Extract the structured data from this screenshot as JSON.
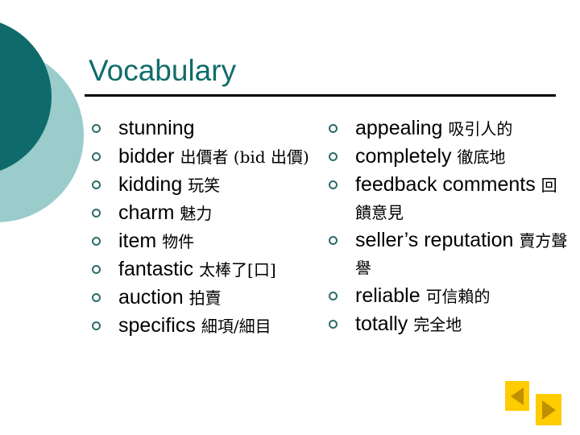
{
  "slide": {
    "title": "Vocabulary",
    "colors": {
      "title_teal": "#116C6C",
      "circle_dark": "#0F6B6B",
      "circle_light": "#9ACCCC",
      "bullet_teal": "#2E6B6B",
      "rule_black": "#000000",
      "nav_button": "#FFCC00",
      "nav_arrow": "#BF9000"
    }
  },
  "columns": {
    "left": [
      {
        "term": "stunning",
        "gloss": ""
      },
      {
        "term": "bidder",
        "gloss": "出價者 (bid 出價)"
      },
      {
        "term": "kidding",
        "gloss": "玩笑"
      },
      {
        "term": "charm",
        "gloss": "魅力"
      },
      {
        "term": "item",
        "gloss": "物件"
      },
      {
        "term": "fantastic",
        "gloss": "太棒了[口]"
      },
      {
        "term": "auction",
        "gloss": "拍賣"
      },
      {
        "term": "specifics",
        "gloss": "細項/細目"
      }
    ],
    "right": [
      {
        "term": "appealing",
        "gloss": "吸引人的"
      },
      {
        "term": "completely",
        "gloss": "徹底地"
      },
      {
        "term": "feedback comments",
        "gloss": "回饋意見"
      },
      {
        "term": "seller’s reputation",
        "gloss": "賣方聲譽"
      },
      {
        "term": "reliable",
        "gloss": "可信賴的"
      },
      {
        "term": "totally",
        "gloss": "完全地"
      }
    ]
  },
  "navigation": {
    "previous_label": "◀",
    "next_label": "▶",
    "previous_icon": "triangle-left-icon",
    "next_icon": "triangle-right-icon"
  }
}
